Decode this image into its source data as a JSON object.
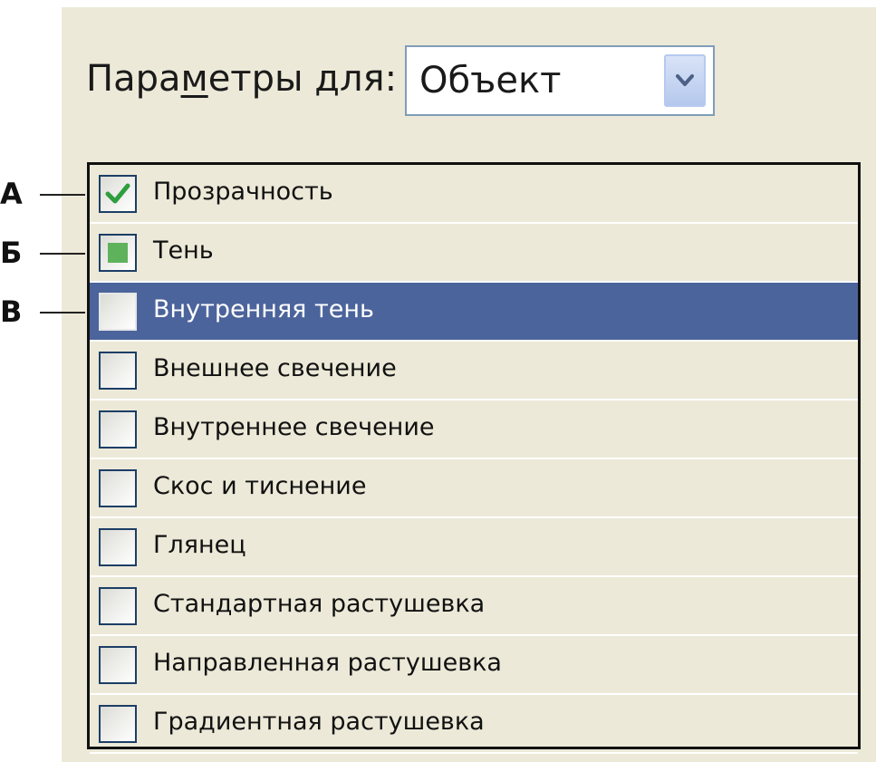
{
  "header": {
    "label_before": "Пара",
    "label_mnemonic": "м",
    "label_after": "етры для:",
    "select": {
      "value": "Объект",
      "icon": "chevron-down-icon"
    }
  },
  "effects": [
    {
      "label": "Прозрачность",
      "state": "checked"
    },
    {
      "label": "Тень",
      "state": "mixed"
    },
    {
      "label": "Внутренняя тень",
      "state": "unchecked",
      "selected": true
    },
    {
      "label": "Внешнее свечение",
      "state": "unchecked"
    },
    {
      "label": "Внутреннее свечение",
      "state": "unchecked"
    },
    {
      "label": "Скос и тиснение",
      "state": "unchecked"
    },
    {
      "label": "Глянец",
      "state": "unchecked"
    },
    {
      "label": "Стандартная растушевка",
      "state": "unchecked"
    },
    {
      "label": "Направленная растушевка",
      "state": "unchecked"
    },
    {
      "label": "Градиентная растушевка",
      "state": "unchecked"
    }
  ],
  "callouts": [
    {
      "letter": "А",
      "row": 0
    },
    {
      "letter": "Б",
      "row": 1
    },
    {
      "letter": "В",
      "row": 2
    }
  ],
  "colors": {
    "panel_bg": "#ece9d8",
    "selection": "#4c649c",
    "check": "#2e9e3e",
    "mixed_fill": "#5fb25c"
  }
}
